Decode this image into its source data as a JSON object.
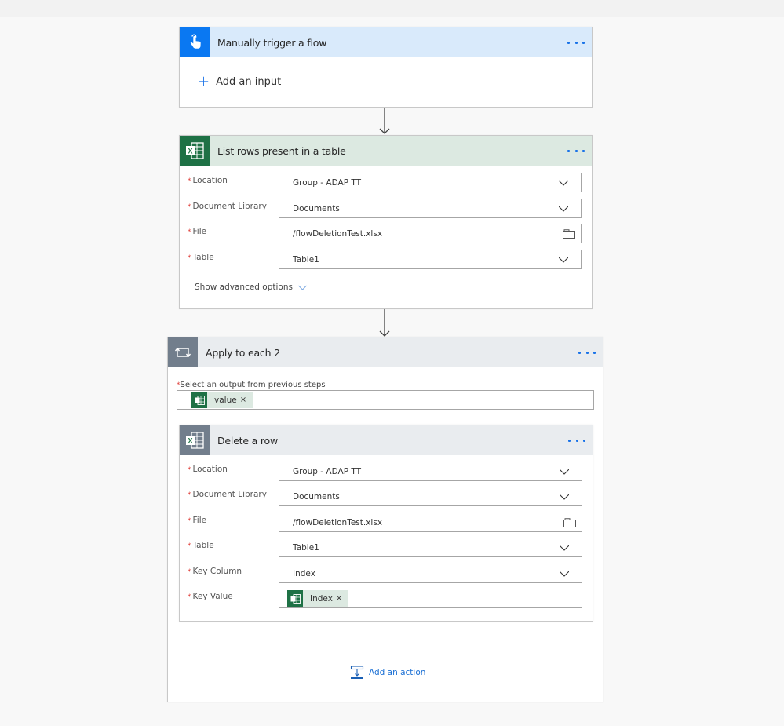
{
  "colors": {
    "trigger_accent": "#0a78f2",
    "excel_accent": "#1e7145",
    "loop_accent": "#727e8c",
    "link_blue": "#1a73e8",
    "required_red": "#e0403b"
  },
  "trigger": {
    "title": "Manually trigger a flow",
    "icon": "touch-hand-icon",
    "add_input_label": "Add an input"
  },
  "list_rows": {
    "title": "List rows present in a table",
    "icon": "excel-icon",
    "fields": [
      {
        "label": "Location",
        "value": "Group - ADAP TT",
        "control": "dropdown"
      },
      {
        "label": "Document Library",
        "value": "Documents",
        "control": "dropdown"
      },
      {
        "label": "File",
        "value": "/flowDeletionTest.xlsx",
        "control": "file-picker"
      },
      {
        "label": "Table",
        "value": "Table1",
        "control": "dropdown"
      }
    ],
    "advanced_label": "Show advanced options"
  },
  "apply_each": {
    "title": "Apply to each 2",
    "icon": "loop-icon",
    "select_label": "Select an output from previous steps",
    "token": "value",
    "add_action_label": "Add an action"
  },
  "delete_row": {
    "title": "Delete a row",
    "icon": "excel-icon",
    "fields": [
      {
        "label": "Location",
        "value": "Group - ADAP TT",
        "control": "dropdown"
      },
      {
        "label": "Document Library",
        "value": "Documents",
        "control": "dropdown"
      },
      {
        "label": "File",
        "value": "/flowDeletionTest.xlsx",
        "control": "file-picker"
      },
      {
        "label": "Table",
        "value": "Table1",
        "control": "dropdown"
      },
      {
        "label": "Key Column",
        "value": "Index",
        "control": "dropdown"
      },
      {
        "label": "Key Value",
        "token": "Index",
        "control": "token"
      }
    ]
  },
  "required_marker": "*",
  "token_close": "×"
}
